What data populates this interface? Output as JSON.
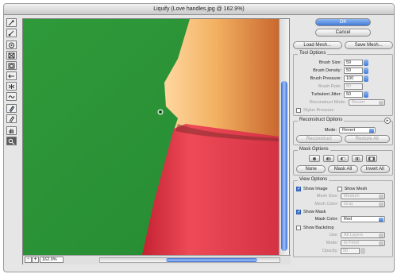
{
  "window": {
    "title": "Liquify (Love handles.jpg @ 162.9%)"
  },
  "toolbar": {
    "tools": [
      "forward-warp",
      "reconstruct",
      "twirl",
      "pucker",
      "bloat",
      "push-left",
      "mirror",
      "turbulence",
      "freeze-mask",
      "thaw-mask",
      "hand",
      "zoom"
    ]
  },
  "canvas": {
    "background_color": "#2f9a3a",
    "skin_color": "#f2b060",
    "shirt_color": "#e2394a"
  },
  "status": {
    "zoom_minus": "-",
    "zoom_plus": "+",
    "zoom": "162.9%"
  },
  "buttons": {
    "ok": "OK",
    "cancel": "Cancel",
    "load_mesh": "Load Mesh...",
    "save_mesh": "Save Mesh..."
  },
  "tool_options": {
    "title": "Tool Options",
    "brush_size_label": "Brush Size:",
    "brush_size": "59",
    "brush_density_label": "Brush Density:",
    "brush_density": "50",
    "brush_pressure_label": "Brush Pressure:",
    "brush_pressure": "100",
    "brush_rate_label": "Brush Rate:",
    "brush_rate": "80",
    "turbulent_jitter_label": "Turbulent Jitter:",
    "turbulent_jitter": "50",
    "reconstruct_mode_label": "Reconstruct Mode:",
    "reconstruct_mode": "Revert",
    "stylus_pressure": "Stylus Pressure"
  },
  "reconstruct_options": {
    "title": "Reconstruct Options",
    "mode_label": "Mode:",
    "mode": "Revert",
    "reconstruct": "Reconstruct",
    "restore_all": "Restore All"
  },
  "mask_options": {
    "title": "Mask Options",
    "none": "None",
    "mask_all": "Mask All",
    "invert_all": "Invert All"
  },
  "view_options": {
    "title": "View Options",
    "show_image": "Show Image",
    "show_mesh": "Show Mesh",
    "mesh_size_label": "Mesh Size:",
    "mesh_size": "Medium",
    "mesh_color_label": "Mesh Color:",
    "mesh_color": "Gray",
    "show_mask": "Show Mask",
    "mask_color_label": "Mask Color:",
    "mask_color": "Red",
    "show_backdrop": "Show Backdrop",
    "use_label": "Use:",
    "use": "All Layers",
    "mode_label": "Mode:",
    "mode": "In Front",
    "opacity_label": "Opacity:",
    "opacity": "50"
  }
}
